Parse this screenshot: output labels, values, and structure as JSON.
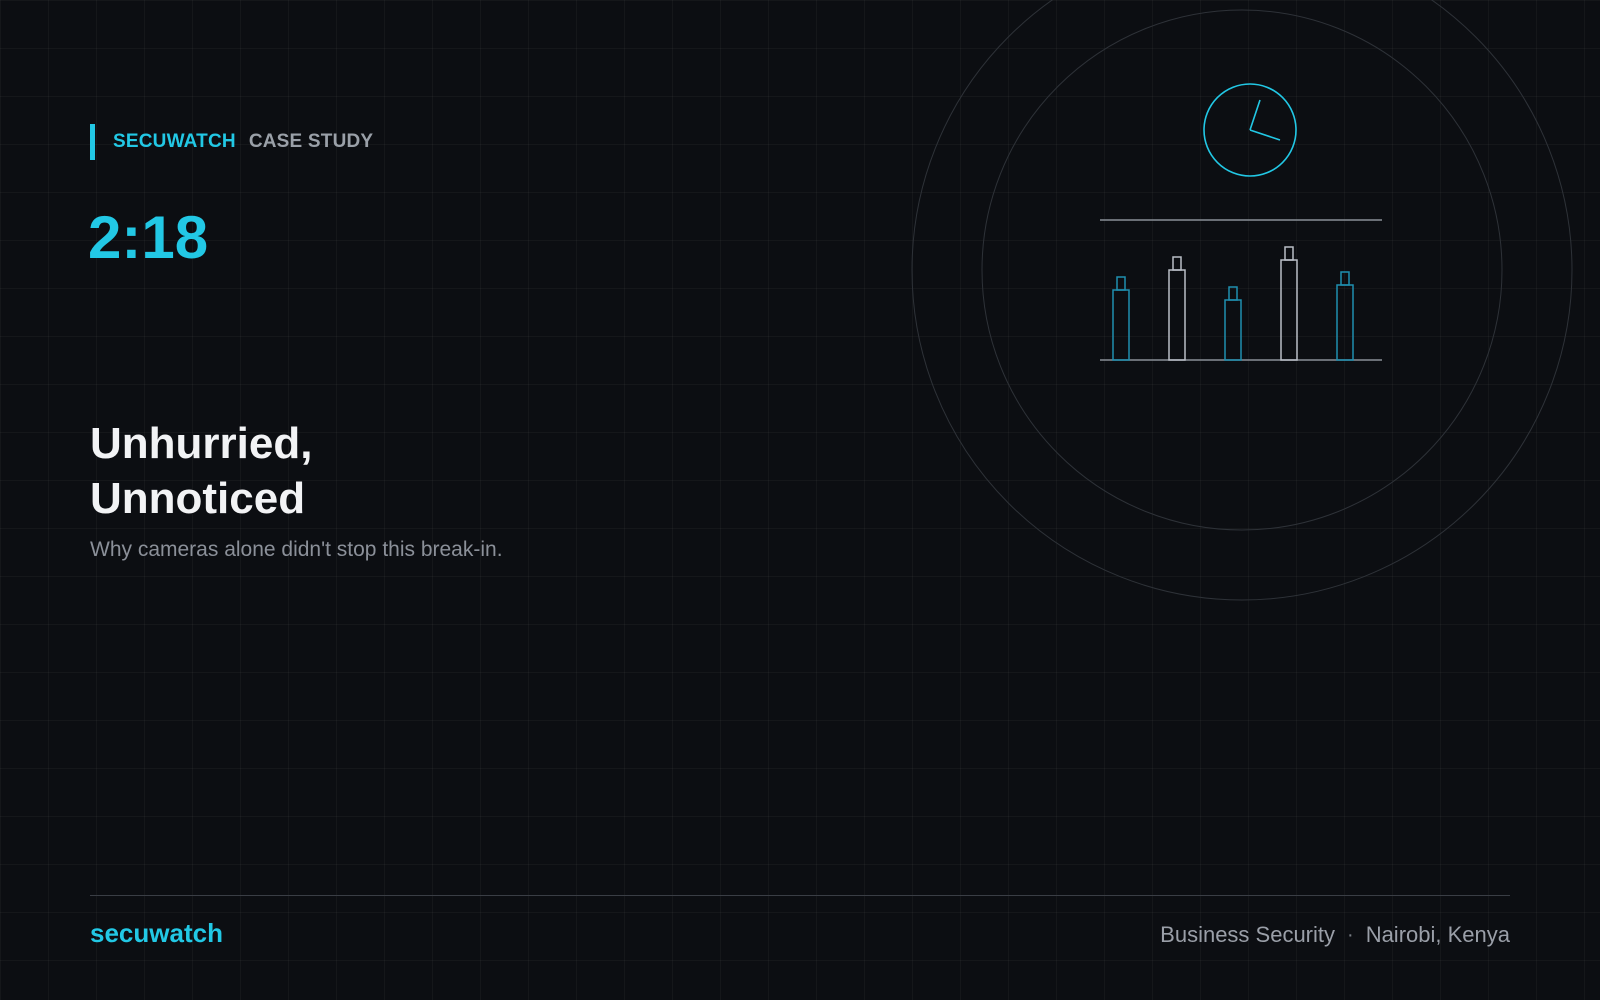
{
  "header": {
    "brand": "SECUWATCH",
    "kind": "CASE STUDY"
  },
  "hero": {
    "time": "2:18",
    "title_line1": "Unhurried,",
    "title_line2": "Unnoticed",
    "subtitle": "Why cameras alone didn't stop this break-in."
  },
  "footer": {
    "brand": "secuwatch",
    "category": "Business Security",
    "separator": "·",
    "location": "Nairobi, Kenya"
  },
  "illustration": {
    "icons": [
      "clock-icon",
      "bar-cylinders-icon"
    ],
    "accent_color": "#22c8e5",
    "neutral_color": "#b9bec6"
  },
  "colors": {
    "background": "#0c0e12",
    "accent": "#22c8e5",
    "text": "#f2f3f5",
    "muted": "#8b9099"
  }
}
